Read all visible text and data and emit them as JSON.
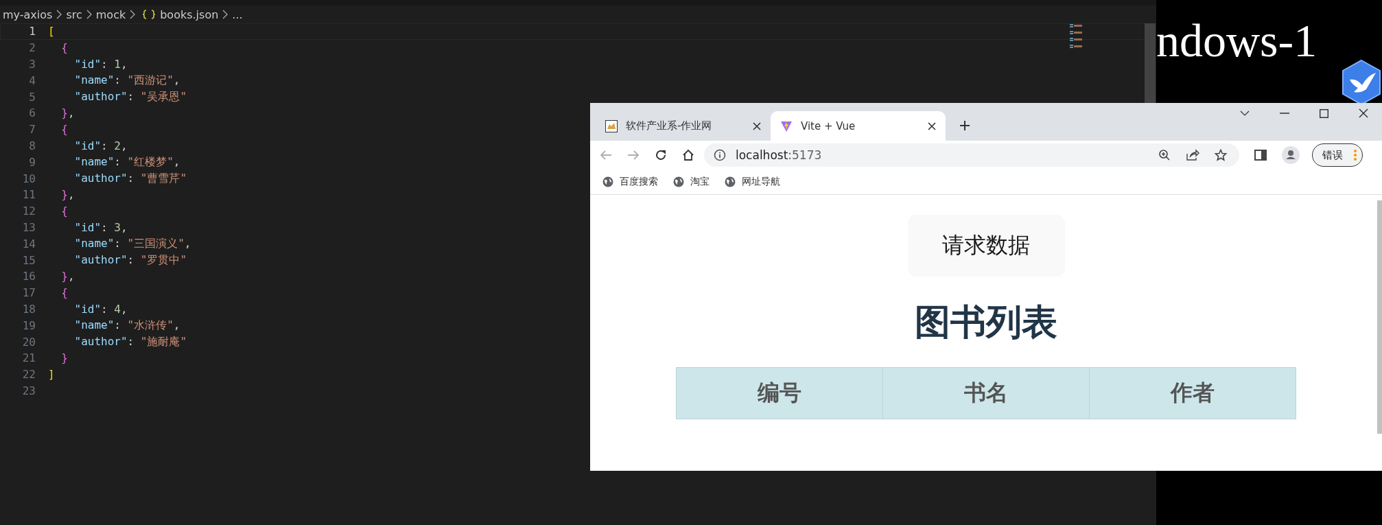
{
  "editor": {
    "breadcrumb": [
      "my-axios",
      "src",
      "mock",
      "books.json",
      "..."
    ],
    "lines": [
      {
        "number": "1",
        "active": true,
        "tokens": [
          {
            "kind": "bracket",
            "text": "["
          }
        ]
      },
      {
        "number": "2",
        "active": false,
        "tokens": [
          {
            "kind": "brace",
            "text": "  {"
          }
        ]
      },
      {
        "number": "3",
        "active": false,
        "tokens": [
          {
            "kind": "key",
            "text": "    \"id\""
          },
          {
            "kind": "punct",
            "text": ": "
          },
          {
            "kind": "number",
            "text": "1"
          },
          {
            "kind": "punct",
            "text": ","
          }
        ]
      },
      {
        "number": "4",
        "active": false,
        "tokens": [
          {
            "kind": "key",
            "text": "    \"name\""
          },
          {
            "kind": "punct",
            "text": ": "
          },
          {
            "kind": "string",
            "text": "\"西游记\""
          },
          {
            "kind": "punct",
            "text": ","
          }
        ]
      },
      {
        "number": "5",
        "active": false,
        "tokens": [
          {
            "kind": "key",
            "text": "    \"author\""
          },
          {
            "kind": "punct",
            "text": ": "
          },
          {
            "kind": "string",
            "text": "\"吴承恩\""
          }
        ]
      },
      {
        "number": "6",
        "active": false,
        "tokens": [
          {
            "kind": "brace",
            "text": "  }"
          },
          {
            "kind": "punct",
            "text": ","
          }
        ]
      },
      {
        "number": "7",
        "active": false,
        "tokens": [
          {
            "kind": "brace",
            "text": "  {"
          }
        ]
      },
      {
        "number": "8",
        "active": false,
        "tokens": [
          {
            "kind": "key",
            "text": "    \"id\""
          },
          {
            "kind": "punct",
            "text": ": "
          },
          {
            "kind": "number",
            "text": "2"
          },
          {
            "kind": "punct",
            "text": ","
          }
        ]
      },
      {
        "number": "9",
        "active": false,
        "tokens": [
          {
            "kind": "key",
            "text": "    \"name\""
          },
          {
            "kind": "punct",
            "text": ": "
          },
          {
            "kind": "string",
            "text": "\"红楼梦\""
          },
          {
            "kind": "punct",
            "text": ","
          }
        ]
      },
      {
        "number": "10",
        "active": false,
        "tokens": [
          {
            "kind": "key",
            "text": "    \"author\""
          },
          {
            "kind": "punct",
            "text": ": "
          },
          {
            "kind": "string",
            "text": "\"曹雪芹\""
          }
        ]
      },
      {
        "number": "11",
        "active": false,
        "tokens": [
          {
            "kind": "brace",
            "text": "  }"
          },
          {
            "kind": "punct",
            "text": ","
          }
        ]
      },
      {
        "number": "12",
        "active": false,
        "tokens": [
          {
            "kind": "brace",
            "text": "  {"
          }
        ]
      },
      {
        "number": "13",
        "active": false,
        "tokens": [
          {
            "kind": "key",
            "text": "    \"id\""
          },
          {
            "kind": "punct",
            "text": ": "
          },
          {
            "kind": "number",
            "text": "3"
          },
          {
            "kind": "punct",
            "text": ","
          }
        ]
      },
      {
        "number": "14",
        "active": false,
        "tokens": [
          {
            "kind": "key",
            "text": "    \"name\""
          },
          {
            "kind": "punct",
            "text": ": "
          },
          {
            "kind": "string",
            "text": "\"三国演义\""
          },
          {
            "kind": "punct",
            "text": ","
          }
        ]
      },
      {
        "number": "15",
        "active": false,
        "tokens": [
          {
            "kind": "key",
            "text": "    \"author\""
          },
          {
            "kind": "punct",
            "text": ": "
          },
          {
            "kind": "string",
            "text": "\"罗贯中\""
          }
        ]
      },
      {
        "number": "16",
        "active": false,
        "tokens": [
          {
            "kind": "brace",
            "text": "  }"
          },
          {
            "kind": "punct",
            "text": ","
          }
        ]
      },
      {
        "number": "17",
        "active": false,
        "tokens": [
          {
            "kind": "brace",
            "text": "  {"
          }
        ]
      },
      {
        "number": "18",
        "active": false,
        "tokens": [
          {
            "kind": "key",
            "text": "    \"id\""
          },
          {
            "kind": "punct",
            "text": ": "
          },
          {
            "kind": "number",
            "text": "4"
          },
          {
            "kind": "punct",
            "text": ","
          }
        ]
      },
      {
        "number": "19",
        "active": false,
        "tokens": [
          {
            "kind": "key",
            "text": "    \"name\""
          },
          {
            "kind": "punct",
            "text": ": "
          },
          {
            "kind": "string",
            "text": "\"水浒传\""
          },
          {
            "kind": "punct",
            "text": ","
          }
        ]
      },
      {
        "number": "20",
        "active": false,
        "tokens": [
          {
            "kind": "key",
            "text": "    \"author\""
          },
          {
            "kind": "punct",
            "text": ": "
          },
          {
            "kind": "string",
            "text": "\"施耐庵\""
          }
        ]
      },
      {
        "number": "21",
        "active": false,
        "tokens": [
          {
            "kind": "brace",
            "text": "  }"
          }
        ]
      },
      {
        "number": "22",
        "active": false,
        "tokens": [
          {
            "kind": "bracket",
            "text": "]"
          }
        ]
      },
      {
        "number": "23",
        "active": false
      }
    ]
  },
  "desktop": {
    "text": "ndows-1"
  },
  "browser": {
    "tabs": [
      {
        "title": "软件产业系-作业网",
        "selected": false
      },
      {
        "title": "Vite + Vue",
        "selected": true
      }
    ],
    "back_disabled": true,
    "forward_disabled": true,
    "address": {
      "host": "localhost",
      "port": ":5173"
    },
    "profile_button": "错误",
    "bookmarks": [
      "百度搜索",
      "淘宝",
      "网址导航"
    ],
    "page": {
      "button": "请求数据",
      "heading": "图书列表",
      "table": {
        "columns": [
          "编号",
          "书名",
          "作者"
        ]
      }
    }
  }
}
